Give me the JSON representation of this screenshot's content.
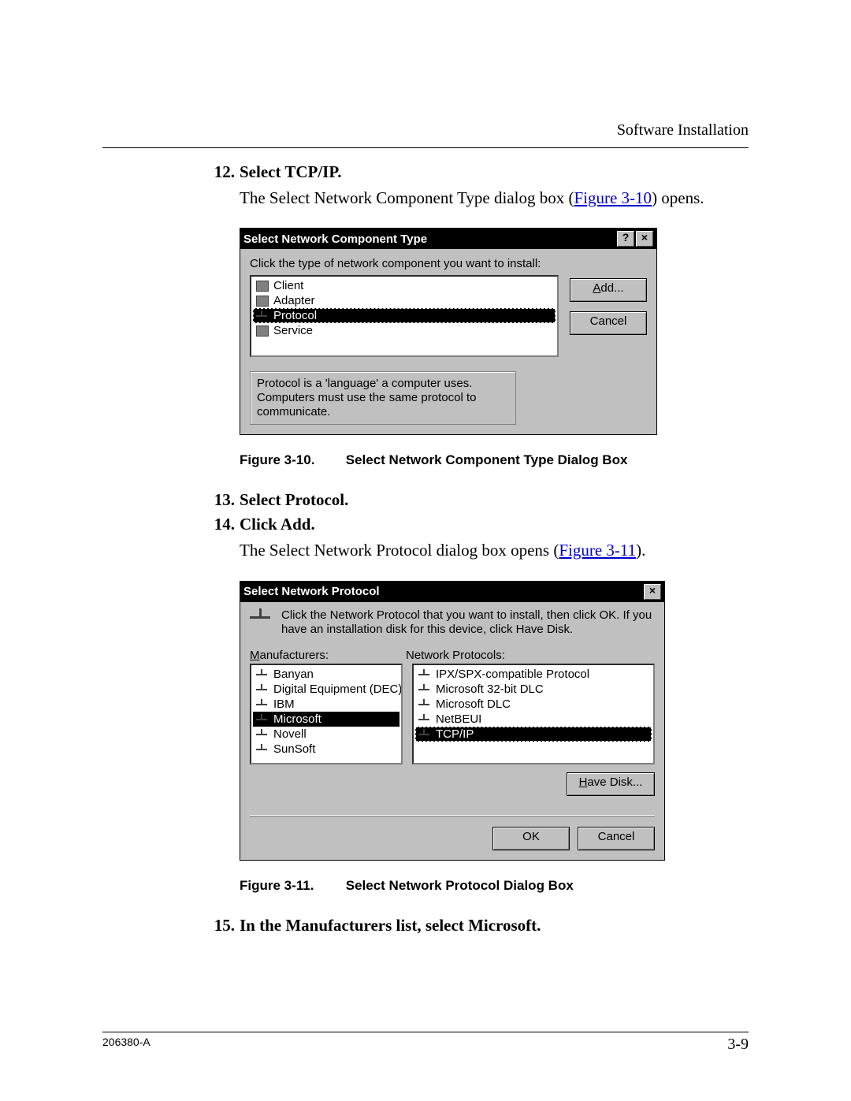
{
  "header": {
    "section": "Software Installation"
  },
  "steps": {
    "s12": {
      "num": "12.",
      "text": "Select TCP/IP."
    },
    "s12_desc_pre": "The Select Network Component Type dialog box (",
    "s12_link": "Figure 3-10",
    "s12_desc_post": ") opens.",
    "s13": {
      "num": "13.",
      "text": "Select Protocol."
    },
    "s14": {
      "num": "14.",
      "text": "Click Add."
    },
    "s14_desc_pre": "The Select Network Protocol dialog box opens (",
    "s14_link": "Figure 3-11",
    "s14_desc_post": ").",
    "s15": {
      "num": "15.",
      "text": "In the Manufacturers list, select Microsoft."
    }
  },
  "fig10": {
    "label": "Figure 3-10.",
    "caption": "Select Network Component Type Dialog Box"
  },
  "fig11": {
    "label": "Figure 3-11.",
    "caption": "Select Network Protocol Dialog Box"
  },
  "dlg1": {
    "title": "Select Network Component Type",
    "help_btn": "?",
    "close_btn": "×",
    "instr": "Click the type of network component you want to install:",
    "items": [
      "Client",
      "Adapter",
      "Protocol",
      "Service"
    ],
    "selected_index": 2,
    "add_btn": "Add...",
    "cancel_btn": "Cancel",
    "desc": "Protocol is a 'language' a computer uses. Computers must use the same protocol to communicate."
  },
  "dlg2": {
    "title": "Select Network Protocol",
    "close_btn": "×",
    "instr": "Click the Network Protocol that you want to install, then click OK. If you have an installation disk for this device, click Have Disk.",
    "mfr_label": "Manufacturers:",
    "prot_label": "Network Protocols:",
    "mfrs": [
      "Banyan",
      "Digital Equipment (DEC)",
      "IBM",
      "Microsoft",
      "Novell",
      "SunSoft"
    ],
    "mfr_selected_index": 3,
    "prots": [
      "IPX/SPX-compatible Protocol",
      "Microsoft 32-bit DLC",
      "Microsoft DLC",
      "NetBEUI",
      "TCP/IP"
    ],
    "prot_selected_index": 4,
    "have_disk_btn": "Have Disk...",
    "ok_btn": "OK",
    "cancel_btn": "Cancel"
  },
  "footer": {
    "docid": "206380-A",
    "page": "3-9"
  }
}
